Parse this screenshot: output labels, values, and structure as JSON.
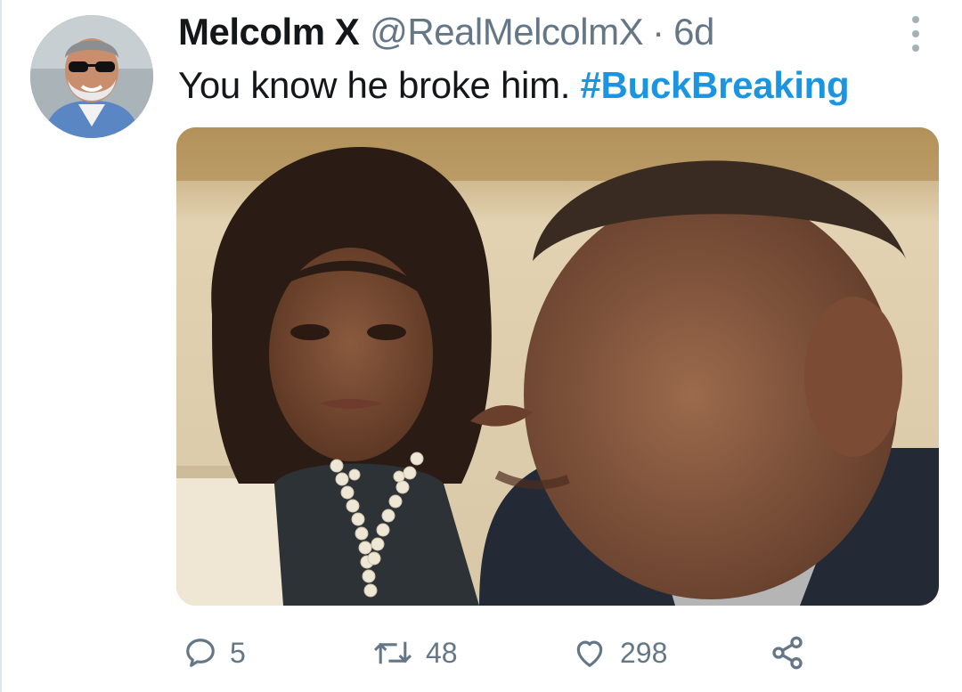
{
  "tweet": {
    "display_name": "Melcolm X",
    "handle": "@RealMelcolmX",
    "separator": "·",
    "time": "6d",
    "text": "You know he broke him. ",
    "hashtag": "#BuckBreaking"
  },
  "actions": {
    "reply_count": "5",
    "retweet_count": "48",
    "like_count": "298"
  },
  "icons": {
    "reply": "speech-bubble-icon",
    "retweet": "retweet-arrows-icon",
    "like": "heart-icon",
    "share": "share-nodes-icon",
    "more": "vertical-ellipsis-icon"
  },
  "colors": {
    "text": "#14171a",
    "secondary": "#657786",
    "link": "#1b95e0"
  }
}
